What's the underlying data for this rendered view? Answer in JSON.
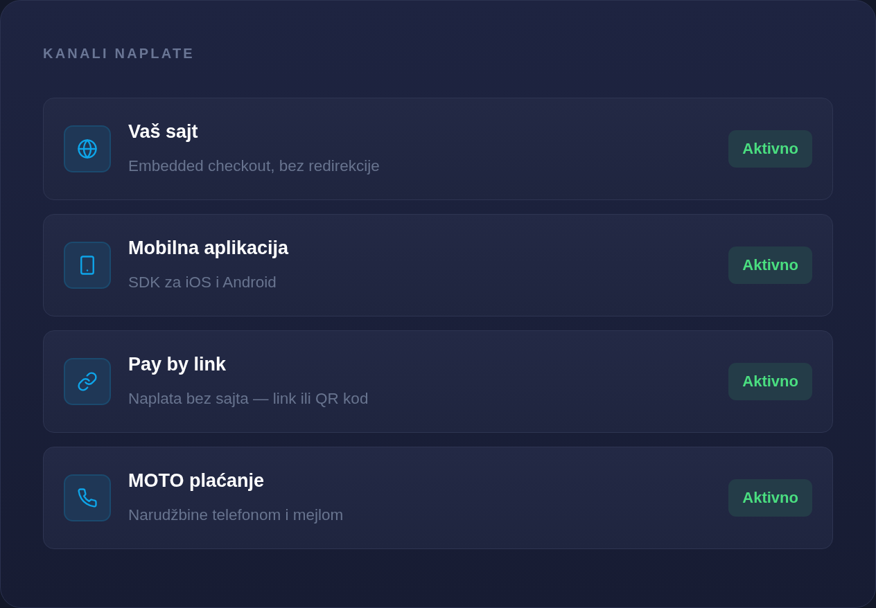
{
  "section_title": "KANALI NAPLATE",
  "channels": [
    {
      "kind": "website",
      "title": "Vaš sajt",
      "description": "Embedded checkout, bez redirekcije",
      "status": {
        "label": "Aktivno",
        "active": true
      }
    },
    {
      "kind": "mobile",
      "title": "Mobilna aplikacija",
      "description": "SDK za iOS i Android",
      "status": {
        "label": "Aktivno",
        "active": true
      }
    },
    {
      "kind": "link",
      "title": "Pay by link",
      "description": "Naplata bez sajta — link ili QR kod",
      "status": {
        "label": "Aktivno",
        "active": true
      }
    },
    {
      "kind": "phone",
      "title": "MOTO plaćanje",
      "description": "Narudžbine telefonom i mejlom",
      "status": {
        "label": "Aktivno",
        "active": true
      }
    }
  ]
}
